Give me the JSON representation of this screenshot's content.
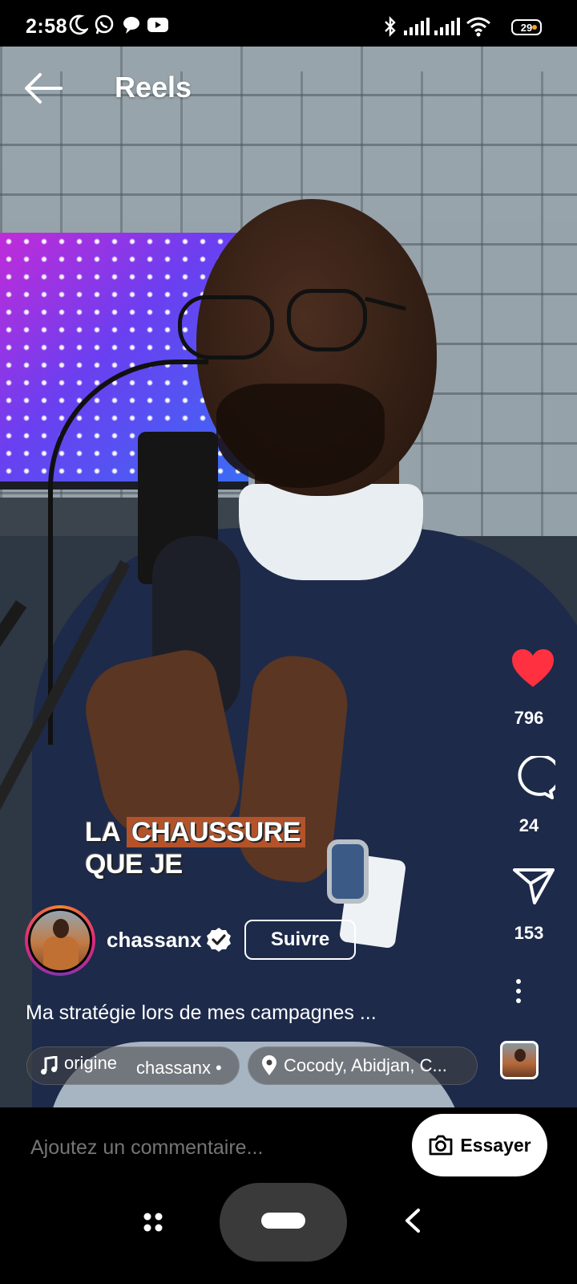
{
  "status_bar": {
    "time": "2:58",
    "battery": "29",
    "icons": [
      "moon-icon",
      "whatsapp-icon",
      "chat-bubble-icon",
      "youtube-icon",
      "bluetooth-icon",
      "signal-icon",
      "signal-icon",
      "wifi-icon",
      "battery-icon"
    ]
  },
  "header": {
    "title": "Reels",
    "back_icon": "arrow-left-icon"
  },
  "video": {
    "caption_line1_pre": "LA ",
    "caption_line1_highlight": "CHAUSSURE",
    "caption_line2": "QUE JE"
  },
  "actions": {
    "likes": "796",
    "comments": "24",
    "shares": "153",
    "like_color": "#ff3040"
  },
  "author": {
    "username": "chassanx",
    "follow_label": "Suivre",
    "verified": true
  },
  "post": {
    "description": "Ma stratégie lors de mes campagnes ...",
    "audio_origin": "origine",
    "audio_author": "chassanx •",
    "location": "Cocody, Abidjan, C..."
  },
  "comment": {
    "placeholder": "Ajoutez un commentaire...",
    "try_label": "Essayer"
  }
}
